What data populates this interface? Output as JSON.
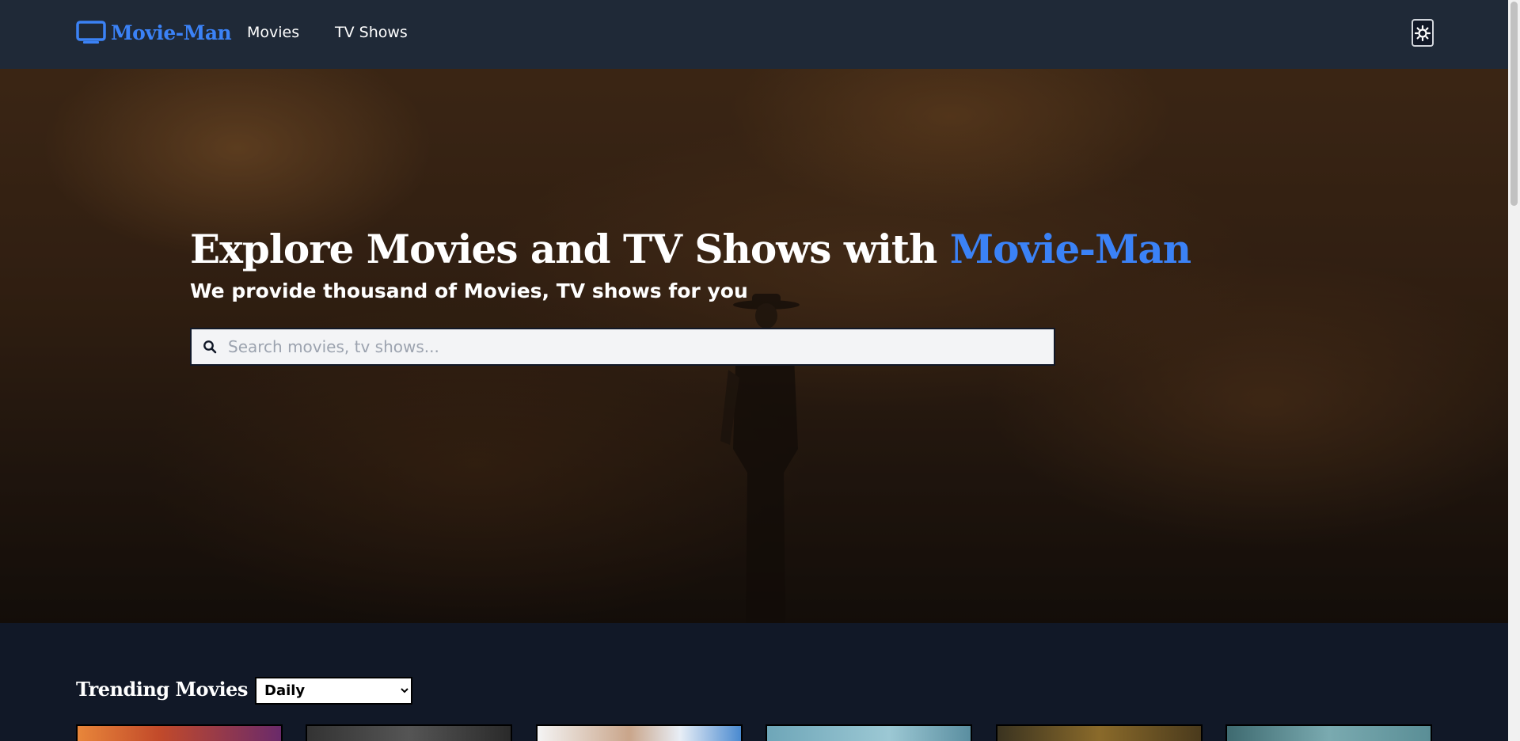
{
  "nav": {
    "logo_text": "Movie-Man",
    "links": [
      "Movies",
      "TV Shows"
    ]
  },
  "hero": {
    "title_main": "Explore Movies and TV Shows with ",
    "title_accent": "Movie-Man",
    "subtitle": "We provide thousand of Movies, TV shows for you",
    "search_placeholder": "Search movies, tv shows..."
  },
  "trending": {
    "title": "Trending Movies",
    "period_selected": "Daily",
    "period_options": [
      "Daily"
    ]
  },
  "colors": {
    "accent": "#3b82f6",
    "navbar_bg": "#1f2937",
    "page_bg": "#111827"
  },
  "icons": {
    "logo": "tv-icon",
    "theme": "sun-icon",
    "search": "search-icon"
  }
}
